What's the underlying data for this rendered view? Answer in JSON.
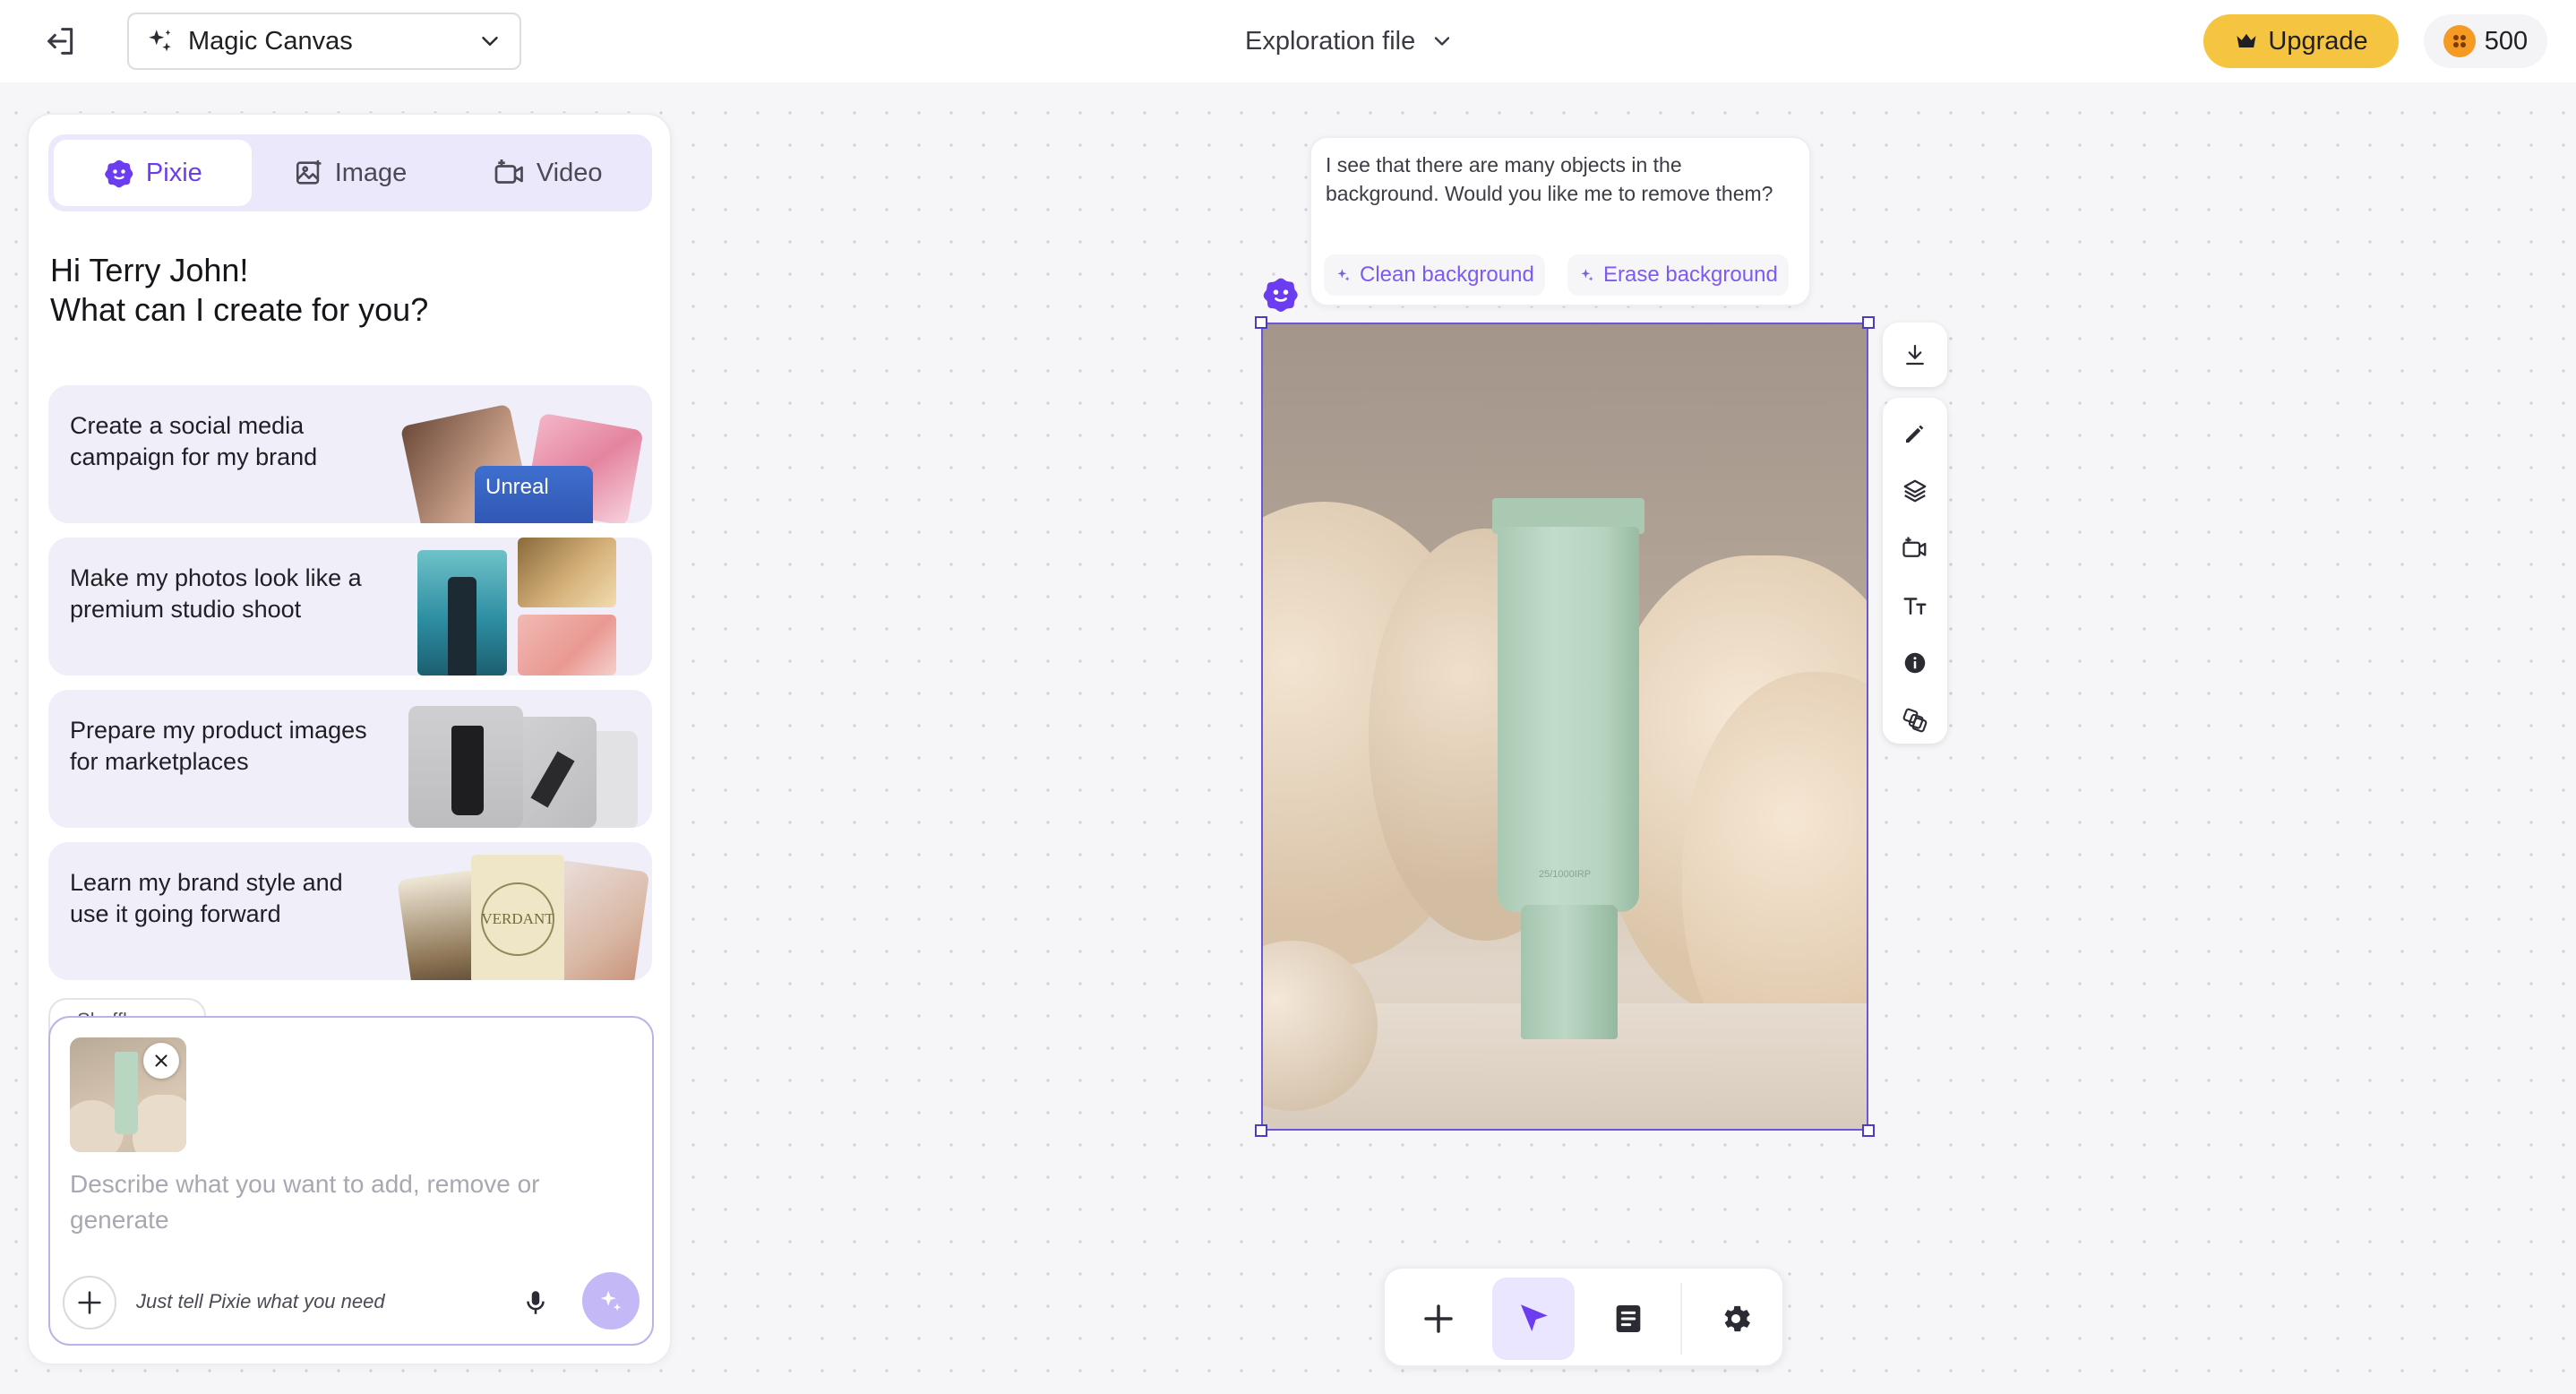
{
  "topbar": {
    "app_name": "Magic Canvas",
    "file_name": "Exploration file",
    "upgrade_label": "Upgrade",
    "credits": "500"
  },
  "panel": {
    "tabs": [
      {
        "label": "Pixie",
        "active": true,
        "icon": "pixie-icon"
      },
      {
        "label": "Image",
        "active": false,
        "icon": "image-icon"
      },
      {
        "label": "Video",
        "active": false,
        "icon": "video-icon"
      }
    ],
    "greeting_line1": "Hi Terry John!",
    "greeting_line2": "What can I create for you?",
    "suggestions": [
      {
        "text": "Create a social media campaign for my brand",
        "thumb_text": "Unreal"
      },
      {
        "text": "Make my photos look like a premium studio shoot"
      },
      {
        "text": "Prepare my product images for marketplaces"
      },
      {
        "text": "Learn my brand style and use it going forward",
        "thumb_text": "VERDANT"
      }
    ],
    "partial_chip": "Shuffle",
    "composer": {
      "placeholder": "Describe what you want to add, remove or generate",
      "hint": "Just tell Pixie what you need"
    }
  },
  "canvas": {
    "bubble_message": "I see that there are many objects in the background. Would you like me to remove them?",
    "chips": [
      "Clean background",
      "Erase background"
    ],
    "tube_label": "25/1000IRP"
  },
  "colors": {
    "accent": "#6c3cf0",
    "upgrade": "#f5c542",
    "coin": "#f59a23",
    "tube": "#b9d6c2"
  }
}
